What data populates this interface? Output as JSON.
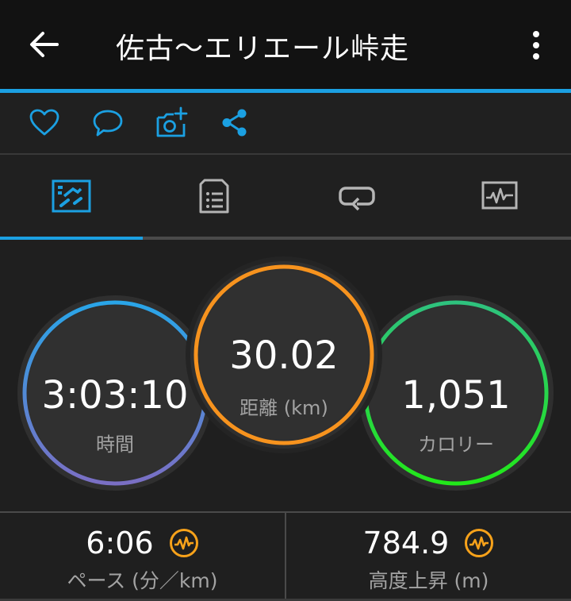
{
  "header": {
    "title": "佐古〜エリエール峠走",
    "back_icon": "arrow-left-icon",
    "menu_icon": "more-vertical-icon"
  },
  "actions": [
    {
      "icon": "heart-icon"
    },
    {
      "icon": "comment-icon"
    },
    {
      "icon": "add-photo-icon"
    },
    {
      "icon": "share-icon"
    }
  ],
  "tabs": [
    {
      "icon": "overview-icon",
      "selected": true
    },
    {
      "icon": "details-icon",
      "selected": false
    },
    {
      "icon": "laps-icon",
      "selected": false
    },
    {
      "icon": "charts-icon",
      "selected": false
    }
  ],
  "gauges": {
    "time": {
      "value": "3:03:10",
      "label": "時間"
    },
    "distance": {
      "value": "30.02",
      "label": "距離 (km)"
    },
    "calories": {
      "value": "1,051",
      "label": "カロリー"
    }
  },
  "stats": {
    "pace": {
      "value": "6:06",
      "label": "ペース (分／km)",
      "icon": "heart-rate-badge-icon"
    },
    "elevation": {
      "value": "784.9",
      "label": "高度上昇 (m)",
      "icon": "heart-rate-badge-icon"
    }
  },
  "colors": {
    "accent": "#1ba0e2",
    "distance_ring": "#f7931e",
    "badge": "#f7a21a",
    "time_ring_top": "#29a5e8",
    "time_ring_bottom": "#7a6fc4",
    "calories_ring_top": "#2ec27e",
    "calories_ring_bottom": "#22e81a"
  }
}
